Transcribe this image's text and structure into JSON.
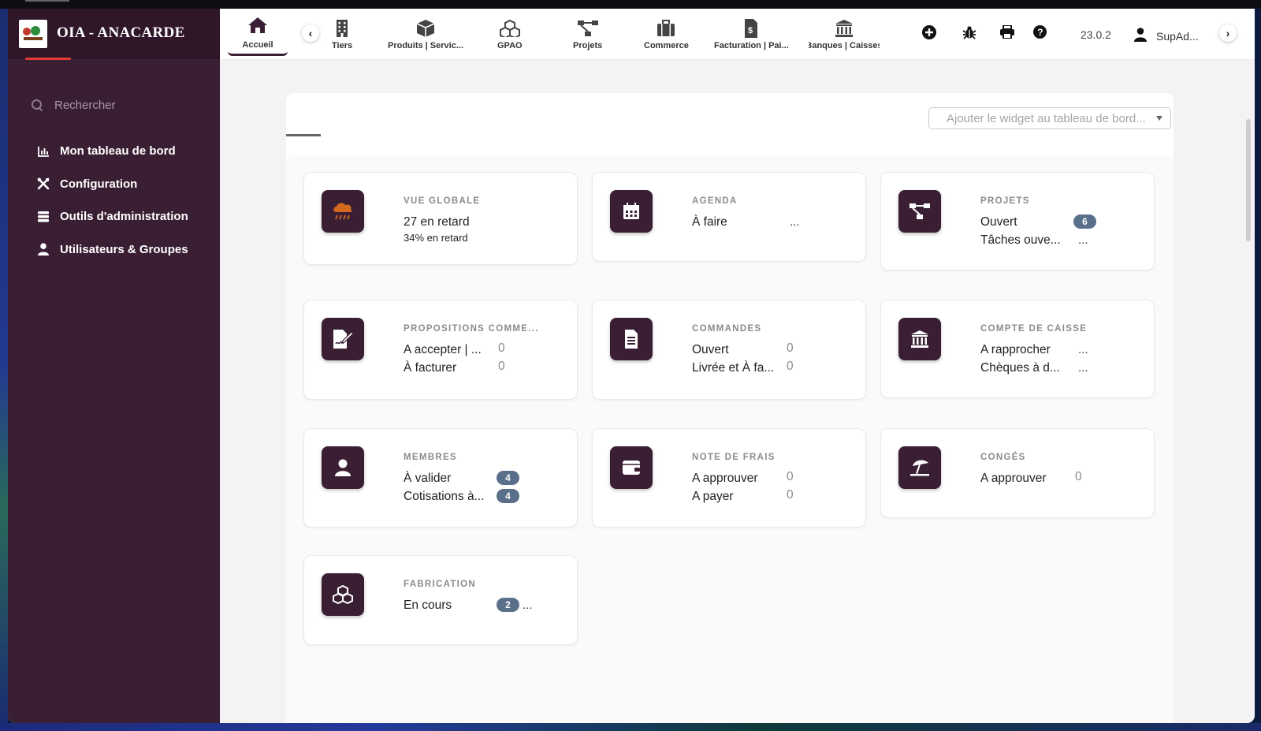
{
  "app": {
    "name": "OIA - ANACARDE",
    "version": "23.0.2",
    "user": "SupAd..."
  },
  "colors": {
    "sidebar": "#3a1f34",
    "accent": "#e53935",
    "badge": "#5a6f8a",
    "icon_tile": "#3a1f34"
  },
  "sidebar": {
    "search_placeholder": "Rechercher",
    "items": [
      {
        "label": "Mon tableau de bord",
        "icon": "chart-icon"
      },
      {
        "label": "Configuration",
        "icon": "tools-icon"
      },
      {
        "label": "Outils d'administration",
        "icon": "server-icon"
      },
      {
        "label": "Utilisateurs & Groupes",
        "icon": "user-icon"
      }
    ]
  },
  "topnav": {
    "home": {
      "label": "Accueil",
      "icon": "home-icon"
    },
    "items": [
      {
        "label": "Tiers",
        "icon": "building-icon"
      },
      {
        "label": "Produits | Servic...",
        "icon": "box-icon"
      },
      {
        "label": "GPAO",
        "icon": "cubes-icon"
      },
      {
        "label": "Projets",
        "icon": "sitemap-icon"
      },
      {
        "label": "Commerce",
        "icon": "briefcase-icon"
      },
      {
        "label": "Facturation | Pai...",
        "icon": "invoice-icon"
      },
      {
        "label": "Banques | Caisses",
        "icon": "bank-icon"
      }
    ]
  },
  "dashboard": {
    "widget_placeholder": "Ajouter le widget au tableau de bord...",
    "cards": [
      {
        "title": "VUE GLOBALE",
        "line1": "27 en retard",
        "line2": "34% en retard"
      },
      {
        "title": "AGENDA",
        "row1": "À faire",
        "row1_val": "..."
      },
      {
        "title": "PROJETS",
        "row1": "Ouvert",
        "row1_badge": "6",
        "row2": "Tâches ouve...",
        "row2_val": "..."
      },
      {
        "title": "PROPOSITIONS COMME...",
        "row1": "A accepter | ...",
        "row1_val": "0",
        "row2": "À facturer",
        "row2_val": "0"
      },
      {
        "title": "COMMANDES",
        "row1": "Ouvert",
        "row1_val": "0",
        "row2": "Livrée et À fa...",
        "row2_val": "0"
      },
      {
        "title": "COMPTE DE CAISSE",
        "row1": "A rapprocher",
        "row1_val": "...",
        "row2": "Chèques à d...",
        "row2_val": "..."
      },
      {
        "title": "MEMBRES",
        "row1": "À valider",
        "row1_badge": "4",
        "row2": "Cotisations à...",
        "row2_badge": "4"
      },
      {
        "title": "NOTE DE FRAIS",
        "row1": "A approuver",
        "row1_val": "0",
        "row2": "A payer",
        "row2_val": "0"
      },
      {
        "title": "CONGÉS",
        "row1": "A approuver",
        "row1_val": "0"
      },
      {
        "title": "FABRICATION",
        "row1": "En cours",
        "row1_badge": "2",
        "row1_val": "..."
      }
    ]
  }
}
